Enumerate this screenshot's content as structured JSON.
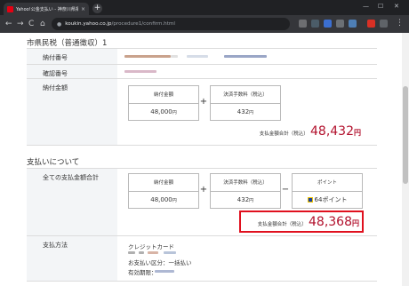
{
  "browser": {
    "tab_title": "Yahoo!公金支払い - 神奈川県相模",
    "tab_close": "×",
    "new_tab": "+",
    "url_host": "koukin.yahoo.co.jp",
    "url_path": "/procedure1/confirm.html",
    "nav": {
      "back": "←",
      "forward": "→",
      "reload": "C",
      "home": "⌂"
    },
    "window": {
      "minimize": "—",
      "maximize": "☐",
      "close": "✕"
    },
    "extension_colors": [
      "#6d6e71",
      "#4b5c68",
      "#3b6fd1",
      "#6b7075",
      "#4e7fb6",
      "#d93025",
      "#5f6368"
    ]
  },
  "page": {
    "section1_title": "市県民税（普通徴収）1",
    "rows1": {
      "payment_number_label": "納付番号",
      "confirm_number_label": "確認番号",
      "amount_label": "納付金額"
    },
    "amount": {
      "pay_head": "納付金額",
      "pay_value": "48,000",
      "fee_head": "決済手数料（税込）",
      "fee_value": "432",
      "yen": "円",
      "plus": "+",
      "total_label": "支払金額合計（税込）",
      "total_value": "48,432",
      "total_unit": "円"
    },
    "section2_title": "支払いについて",
    "rows2": {
      "all_total_label": "全ての支払金額合計",
      "method_label": "支払方法"
    },
    "all_total": {
      "pay_head": "納付金額",
      "pay_value": "48,000",
      "fee_head": "決済手数料（税込）",
      "fee_value": "432",
      "point_head": "ポイント",
      "point_value": "64ポイント",
      "yen": "円",
      "plus": "+",
      "minus": "−",
      "total_label": "支払金額合計（税込）",
      "total_value": "48,368",
      "total_unit": "円"
    },
    "method": {
      "card": "クレジットカード",
      "installment": "お支払い区分：一括払い",
      "expiry_label": "有効期限："
    },
    "colors": {
      "accent_red": "#b2102c",
      "highlight_border": "#e0101e",
      "label_bg": "#f3f5f7"
    }
  }
}
